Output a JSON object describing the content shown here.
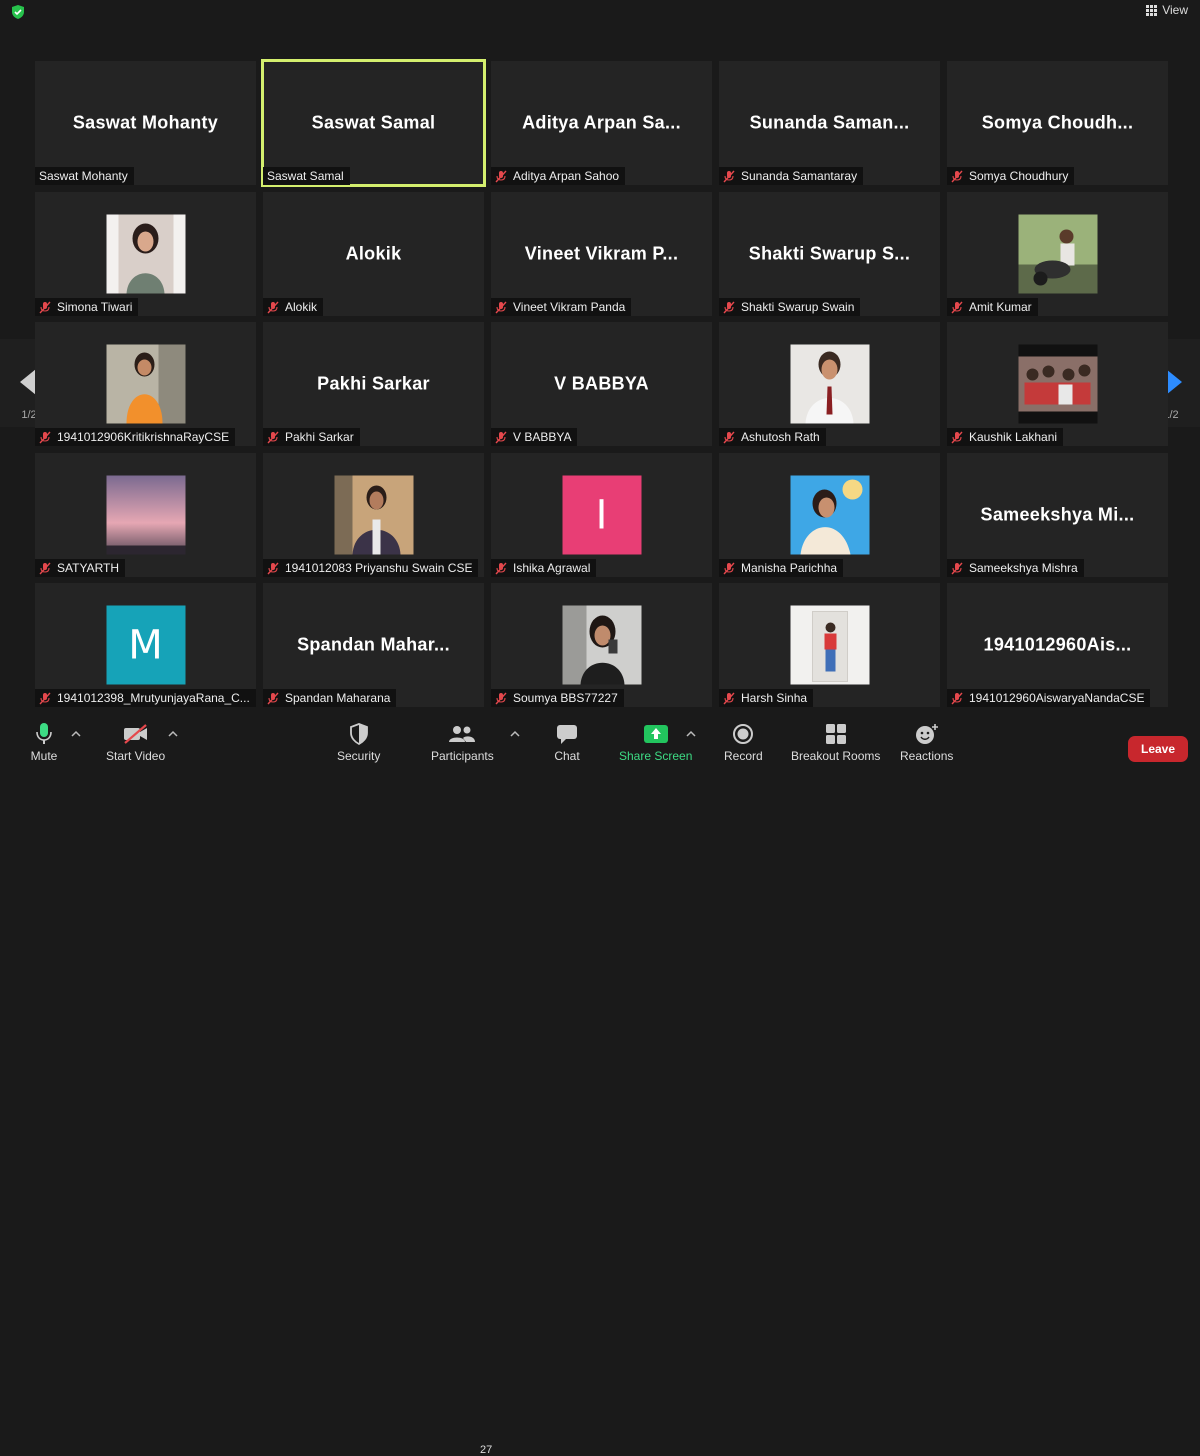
{
  "top": {
    "view_label": "View"
  },
  "pagination": {
    "left": "1/2",
    "right": "1/2"
  },
  "tiles": [
    {
      "name": "Saswat Mohanty",
      "display": "Saswat Mohanty",
      "muted": false,
      "kind": "text"
    },
    {
      "name": "Saswat Samal",
      "display": "Saswat Samal",
      "muted": false,
      "kind": "text",
      "active": true
    },
    {
      "name": "Aditya Arpan Sahoo",
      "display": "Aditya  Arpan  Sa...",
      "muted": true,
      "kind": "text"
    },
    {
      "name": "Sunanda Samantaray",
      "display": "Sunanda  Saman...",
      "muted": true,
      "kind": "text"
    },
    {
      "name": "Somya Choudhury",
      "display": "Somya  Choudh...",
      "muted": true,
      "kind": "text"
    },
    {
      "name": "Simona Tiwari",
      "muted": true,
      "kind": "photo",
      "photo": "girl"
    },
    {
      "name": "Alokik",
      "display": "Alokik",
      "muted": true,
      "kind": "text"
    },
    {
      "name": "Vineet Vikram Panda",
      "display": "Vineet  Vikram  P...",
      "muted": true,
      "kind": "text"
    },
    {
      "name": "Shakti Swarup Swain",
      "display": "Shakti  Swarup  S...",
      "muted": true,
      "kind": "text"
    },
    {
      "name": "Amit Kumar",
      "muted": true,
      "kind": "photo",
      "photo": "bike"
    },
    {
      "name": "1941012906KritikrishnaRayCSE",
      "muted": true,
      "kind": "photo",
      "photo": "orange"
    },
    {
      "name": "Pakhi Sarkar",
      "display": "Pakhi Sarkar",
      "muted": true,
      "kind": "text"
    },
    {
      "name": "V BABBYA",
      "display": "V BABBYA",
      "muted": true,
      "kind": "text"
    },
    {
      "name": "Ashutosh Rath",
      "muted": true,
      "kind": "photo",
      "photo": "suit"
    },
    {
      "name": "Kaushik Lakhani",
      "muted": true,
      "kind": "photo",
      "photo": "family"
    },
    {
      "name": "SATYARTH",
      "muted": true,
      "kind": "photo",
      "photo": "sky"
    },
    {
      "name": "1941012083 Priyanshu Swain CSE",
      "muted": true,
      "kind": "photo",
      "photo": "vest"
    },
    {
      "name": "Ishika Agrawal",
      "muted": true,
      "kind": "letter",
      "letter": "I",
      "color": "#e83e75"
    },
    {
      "name": "Manisha Parichha",
      "muted": true,
      "kind": "photo",
      "photo": "blue"
    },
    {
      "name": "Sameekshya Mishra",
      "display": "Sameekshya  Mi...",
      "muted": true,
      "kind": "text"
    },
    {
      "name": "1941012398_MrutyunjayaRana_C...",
      "muted": true,
      "kind": "letter",
      "letter": "M",
      "color": "#16a3b8"
    },
    {
      "name": "Spandan Maharana",
      "display": "Spandan  Mahar...",
      "muted": true,
      "kind": "text"
    },
    {
      "name": "Soumya BBS77227",
      "muted": true,
      "kind": "photo",
      "photo": "selfie"
    },
    {
      "name": "Harsh Sinha",
      "muted": true,
      "kind": "photo",
      "photo": "white"
    },
    {
      "name": "1941012960AiswaryaNandaCSE",
      "display": "1941012960Ais...",
      "muted": true,
      "kind": "text"
    }
  ],
  "toolbar": {
    "mute": "Mute",
    "start_video": "Start Video",
    "security": "Security",
    "participants": "Participants",
    "participants_count": "27",
    "chat": "Chat",
    "share_screen": "Share Screen",
    "record": "Record",
    "breakout_rooms": "Breakout Rooms",
    "reactions": "Reactions",
    "leave": "Leave"
  },
  "colors": {
    "active_border": "#d4ef6e",
    "share_green": "#22c55e",
    "leave_red": "#c8272d",
    "mute_red": "#e5484d"
  }
}
